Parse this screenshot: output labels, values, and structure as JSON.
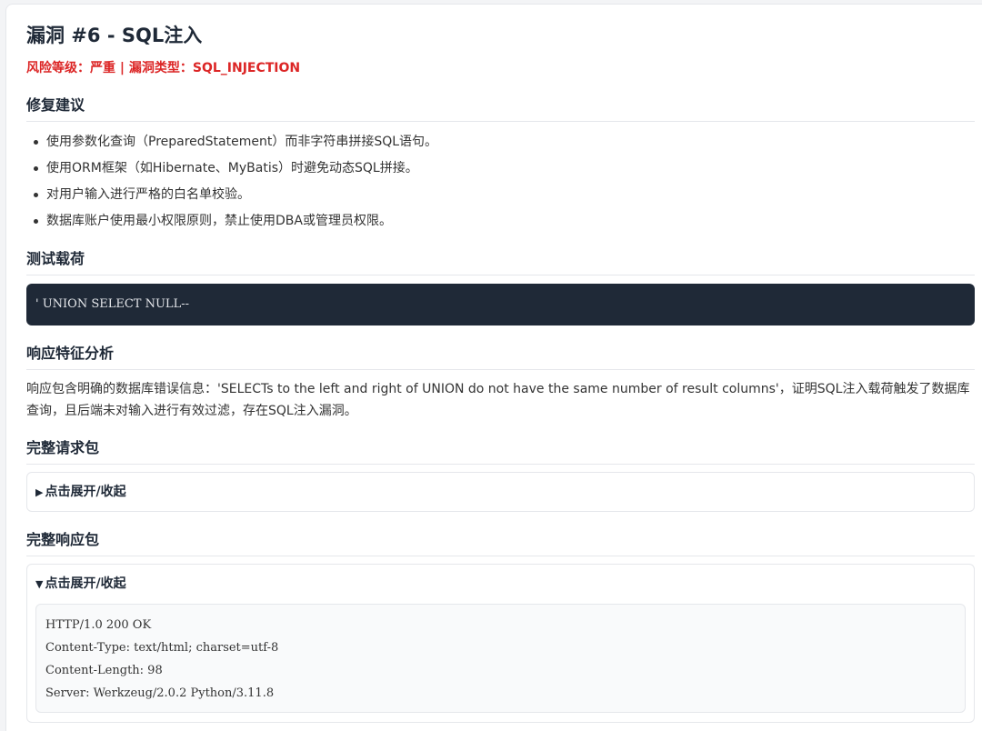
{
  "vuln": {
    "title": "漏洞 #6 - SQL注入",
    "risk_line": "风险等级：严重 | 漏洞类型：SQL_INJECTION"
  },
  "fix": {
    "heading": "修复建议",
    "items": [
      "使用参数化查询（PreparedStatement）而非字符串拼接SQL语句。",
      "使用ORM框架（如Hibernate、MyBatis）时避免动态SQL拼接。",
      "对用户输入进行严格的白名单校验。",
      "数据库账户使用最小权限原则，禁止使用DBA或管理员权限。"
    ]
  },
  "payload": {
    "heading": "测试载荷",
    "code": "' UNION SELECT NULL--"
  },
  "analysis": {
    "heading": "响应特征分析",
    "text": "响应包含明确的数据库错误信息：'SELECTs to the left and right of UNION do not have the same number of result columns'，证明SQL注入载荷触发了数据库查询，且后端未对输入进行有效过滤，存在SQL注入漏洞。"
  },
  "request": {
    "heading": "完整请求包",
    "toggle": "点击展开/收起",
    "collapsed_marker": "▶"
  },
  "response": {
    "heading": "完整响应包",
    "toggle": "点击展开/收起",
    "expanded_marker": "▼",
    "lines": [
      "HTTP/1.0 200 OK",
      "Content-Type: text/html; charset=utf-8",
      "Content-Length: 98",
      "Server: Werkzeug/2.0.2 Python/3.11.8"
    ]
  }
}
